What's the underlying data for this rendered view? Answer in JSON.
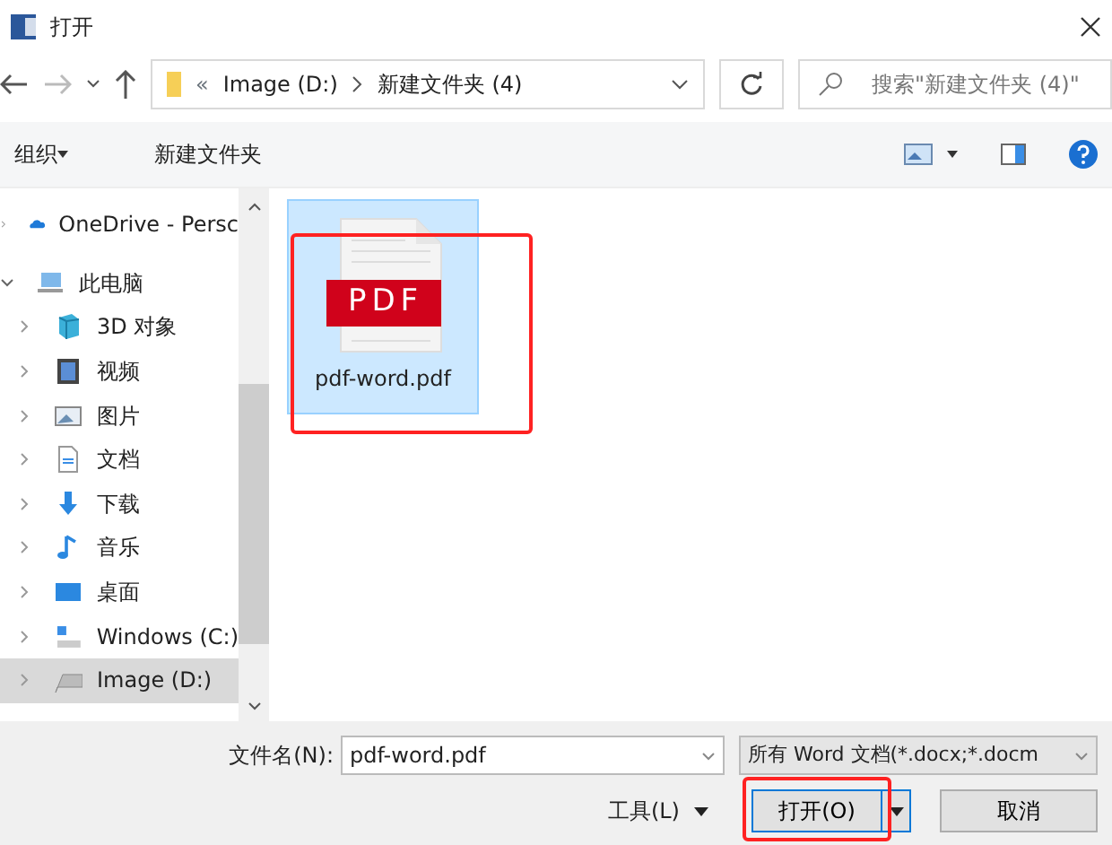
{
  "window": {
    "title": "打开"
  },
  "address": {
    "overflow": "«",
    "segments": [
      "Image (D:)",
      "新建文件夹 (4)"
    ]
  },
  "search": {
    "placeholder": "搜索\"新建文件夹 (4)\""
  },
  "toolbar": {
    "organize": "组织",
    "new_folder": "新建文件夹"
  },
  "sidebar": {
    "items": [
      {
        "label": "OneDrive - Persc",
        "expanded": false,
        "selected": false
      },
      {
        "label": "此电脑",
        "expanded": true,
        "selected": false,
        "children": [
          {
            "label": "3D 对象",
            "expanded": false,
            "selected": false
          },
          {
            "label": "视频",
            "expanded": false,
            "selected": false
          },
          {
            "label": "图片",
            "expanded": false,
            "selected": false
          },
          {
            "label": "文档",
            "expanded": false,
            "selected": false
          },
          {
            "label": "下载",
            "expanded": false,
            "selected": false
          },
          {
            "label": "音乐",
            "expanded": false,
            "selected": false
          },
          {
            "label": "桌面",
            "expanded": false,
            "selected": false
          },
          {
            "label": "Windows  (C:)",
            "expanded": false,
            "selected": false
          },
          {
            "label": "Image (D:)",
            "expanded": false,
            "selected": true
          }
        ]
      }
    ]
  },
  "files": [
    {
      "name": "pdf-word.pdf",
      "badge": "PDF",
      "selected": true,
      "annotated": true
    }
  ],
  "bottom": {
    "filename_label": "文件名(N):",
    "filename": "pdf-word.pdf",
    "filter": "所有 Word 文档(*.docx;*.docm",
    "tools": "工具(L)",
    "open": "打开(O)",
    "open_annotated": true,
    "cancel": "取消"
  }
}
